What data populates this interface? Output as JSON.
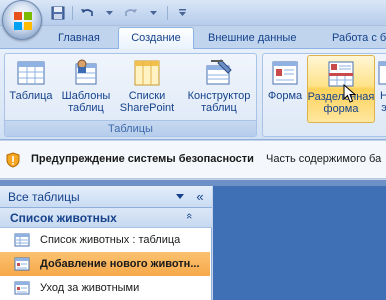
{
  "tabs": {
    "home": "Главная",
    "create": "Создание",
    "external": "Внешние данные",
    "db_tools": "Работа с б"
  },
  "ribbon": {
    "tables_group": {
      "label": "Таблицы",
      "table": "Таблица",
      "templates_l1": "Шаблоны",
      "templates_l2": "таблиц",
      "sharepoint_l1": "Списки",
      "sharepoint_l2": "SharePoint",
      "designer_l1": "Конструктор",
      "designer_l2": "таблиц"
    },
    "forms_group": {
      "form": "Форма",
      "split_l1": "Разделенная",
      "split_l2": "форма",
      "next_l1": "Н",
      "next_l2": "э"
    }
  },
  "security": {
    "title": "Предупреждение системы безопасности",
    "text": "Часть содержимого ба"
  },
  "nav": {
    "header": "Все таблицы",
    "collapse": "«",
    "group_title": "Список животных",
    "group_chevron": "«",
    "items": [
      {
        "label": "Список животных : таблица"
      },
      {
        "label": "Добавление нового животн..."
      },
      {
        "label": "Уход за животными"
      }
    ]
  },
  "colors": {
    "accent": "#15428b",
    "selected": "#f6a84a",
    "workspace": "#3f6fb4"
  }
}
